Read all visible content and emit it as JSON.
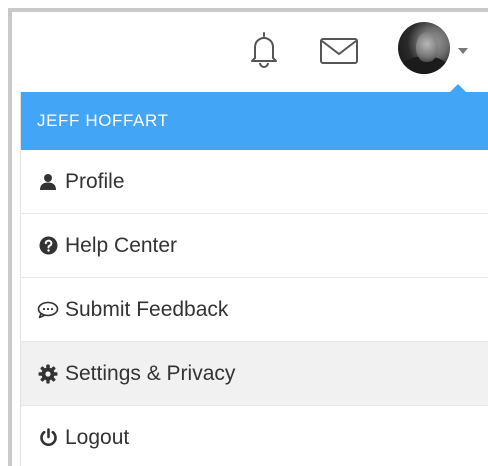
{
  "header": {
    "user_name": "JEFF HOFFART",
    "icons": [
      "bell-icon",
      "mail-icon",
      "avatar",
      "caret-down-icon"
    ]
  },
  "menu": {
    "items": [
      {
        "label": "Profile",
        "icon": "user-icon"
      },
      {
        "label": "Help Center",
        "icon": "question-circle-icon"
      },
      {
        "label": "Submit Feedback",
        "icon": "comment-icon"
      },
      {
        "label": "Settings & Privacy",
        "icon": "gear-icon"
      },
      {
        "label": "Logout",
        "icon": "power-icon"
      }
    ],
    "hovered_item": "Settings & Privacy"
  },
  "colors": {
    "header_bg": "#42a5f5",
    "header_text": "#ffffff",
    "item_text": "#333333",
    "hover_bg": "#f1f1f1"
  }
}
